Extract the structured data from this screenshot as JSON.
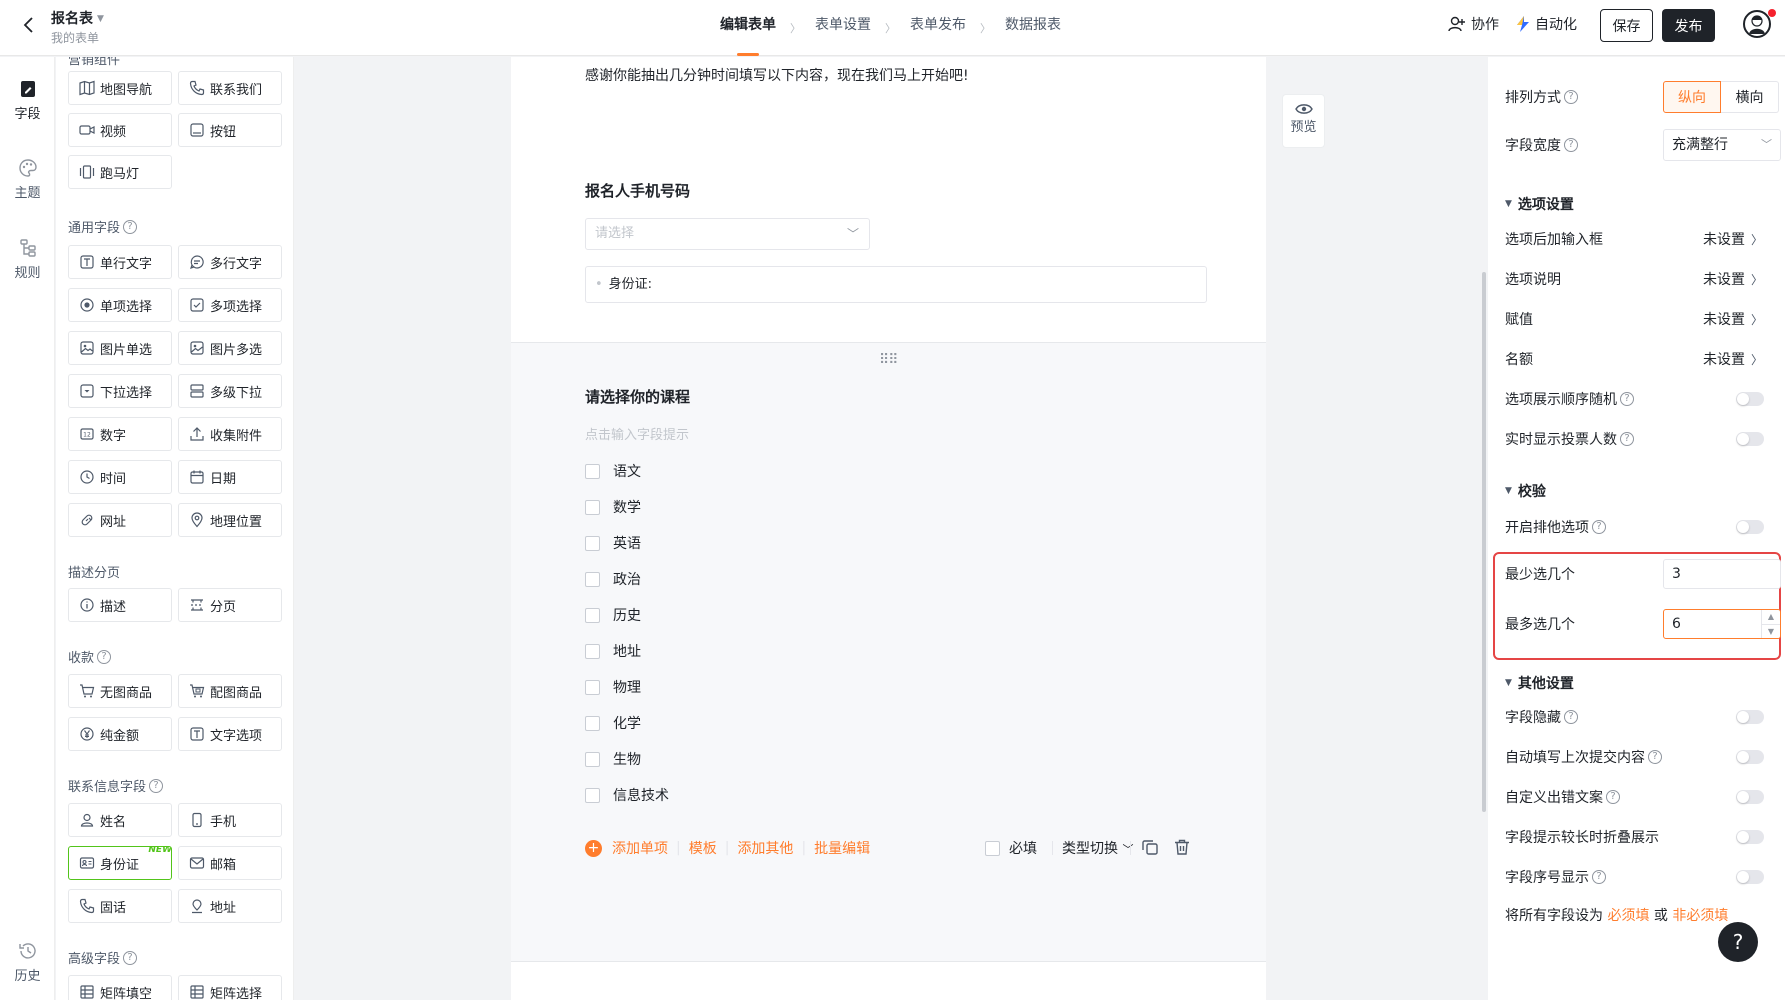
{
  "header": {
    "title": "报名表",
    "subtitle": "我的表单",
    "steps": [
      "编辑表单",
      "表单设置",
      "表单发布",
      "数据报表"
    ],
    "collab_label": "协作",
    "auto_label": "自动化",
    "save_label": "保存",
    "publish_label": "发布"
  },
  "rail": {
    "fields_label": "字段",
    "theme_label": "主题",
    "rules_label": "规则",
    "history_label": "历史"
  },
  "widgets": {
    "top_cut_label": "营销组件",
    "marketing": [
      {
        "label": "地图导航",
        "icon": "map-icon"
      },
      {
        "label": "联系我们",
        "icon": "phone-call-icon"
      },
      {
        "label": "视频",
        "icon": "video-icon"
      },
      {
        "label": "按钮",
        "icon": "button-icon"
      },
      {
        "label": "跑马灯",
        "icon": "marquee-icon"
      }
    ],
    "general_title": "通用字段",
    "general": [
      {
        "label": "单行文字",
        "icon": "text-icon"
      },
      {
        "label": "多行文字",
        "icon": "multiline-icon"
      },
      {
        "label": "单项选择",
        "icon": "radio-icon"
      },
      {
        "label": "多项选择",
        "icon": "checkbox-icon"
      },
      {
        "label": "图片单选",
        "icon": "image-icon"
      },
      {
        "label": "图片多选",
        "icon": "images-icon"
      },
      {
        "label": "下拉选择",
        "icon": "dropdown-icon"
      },
      {
        "label": "多级下拉",
        "icon": "cascade-icon"
      },
      {
        "label": "数字",
        "icon": "number-icon"
      },
      {
        "label": "收集附件",
        "icon": "upload-icon"
      },
      {
        "label": "时间",
        "icon": "clock-icon"
      },
      {
        "label": "日期",
        "icon": "calendar-icon"
      },
      {
        "label": "网址",
        "icon": "link-icon"
      },
      {
        "label": "地理位置",
        "icon": "location-icon"
      }
    ],
    "desc_title": "描述分页",
    "desc": [
      {
        "label": "描述",
        "icon": "info-icon"
      },
      {
        "label": "分页",
        "icon": "pagebreak-icon"
      }
    ],
    "pay_title": "收款",
    "pay": [
      {
        "label": "无图商品",
        "icon": "cart-icon"
      },
      {
        "label": "配图商品",
        "icon": "cart-image-icon"
      },
      {
        "label": "纯金额",
        "icon": "yen-icon"
      },
      {
        "label": "文字选项",
        "icon": "text-option-icon"
      }
    ],
    "contact_title": "联系信息字段",
    "contact": [
      {
        "label": "姓名",
        "icon": "user-icon"
      },
      {
        "label": "手机",
        "icon": "mobile-icon"
      },
      {
        "label": "身份证",
        "icon": "id-card-icon",
        "tag": "NEW"
      },
      {
        "label": "邮箱",
        "icon": "mail-icon"
      },
      {
        "label": "固话",
        "icon": "telephone-icon"
      },
      {
        "label": "地址",
        "icon": "address-icon"
      }
    ],
    "advanced_title": "高级字段",
    "advanced": [
      {
        "label": "矩阵填空",
        "icon": "matrix-icon"
      },
      {
        "label": "矩阵选择",
        "icon": "matrix-select-icon"
      }
    ]
  },
  "canvas": {
    "intro": "感谢你能抽出几分钟时间填写以下内容，现在我们马上开始吧!",
    "q1_title": "报名人手机号码",
    "q1_placeholder": "请选择",
    "q1_sub": "身份证:",
    "q2_title": "请选择你的课程",
    "q2_hint": "点击输入字段提示",
    "q2_options": [
      "语文",
      "数学",
      "英语",
      "政治",
      "历史",
      "地址",
      "物理",
      "化学",
      "生物",
      "信息技术"
    ],
    "actions": {
      "add_option": "添加单项",
      "template": "模板",
      "add_other": "添加其他",
      "batch_edit": "批量编辑",
      "required": "必填",
      "type_switch": "类型切换"
    },
    "preview_label": "预览"
  },
  "settings": {
    "arrange_label": "排列方式",
    "arrange_options": [
      "纵向",
      "横向"
    ],
    "arrange_selected": "纵向",
    "width_label": "字段宽度",
    "width_value": "充满整行",
    "options_section": "选项设置",
    "option_rows": [
      {
        "label": "选项后加输入框",
        "value": "未设置"
      },
      {
        "label": "选项说明",
        "value": "未设置"
      },
      {
        "label": "赋值",
        "value": "未设置"
      },
      {
        "label": "名额",
        "value": "未设置"
      }
    ],
    "random_order_label": "选项展示顺序随机",
    "show_votes_label": "实时显示投票人数",
    "validation_section": "校验",
    "exclusive_label": "开启排他选项",
    "min_label": "最少选几个",
    "min_value": "3",
    "max_label": "最多选几个",
    "max_value": "6",
    "other_section": "其他设置",
    "hide_label": "字段隐藏",
    "autofill_label": "自动填写上次提交内容",
    "custom_error_label": "自定义出错文案",
    "collapse_label": "字段提示较长时折叠展示",
    "show_index_label": "字段序号显示",
    "bottom_prefix": "将所有字段设为",
    "bottom_required": "必须填",
    "bottom_or": "或",
    "bottom_optional": "非必须填"
  },
  "colors": {
    "accent": "#ff7d2d",
    "highlight_border": "#e54545",
    "dark": "#1f2329"
  }
}
